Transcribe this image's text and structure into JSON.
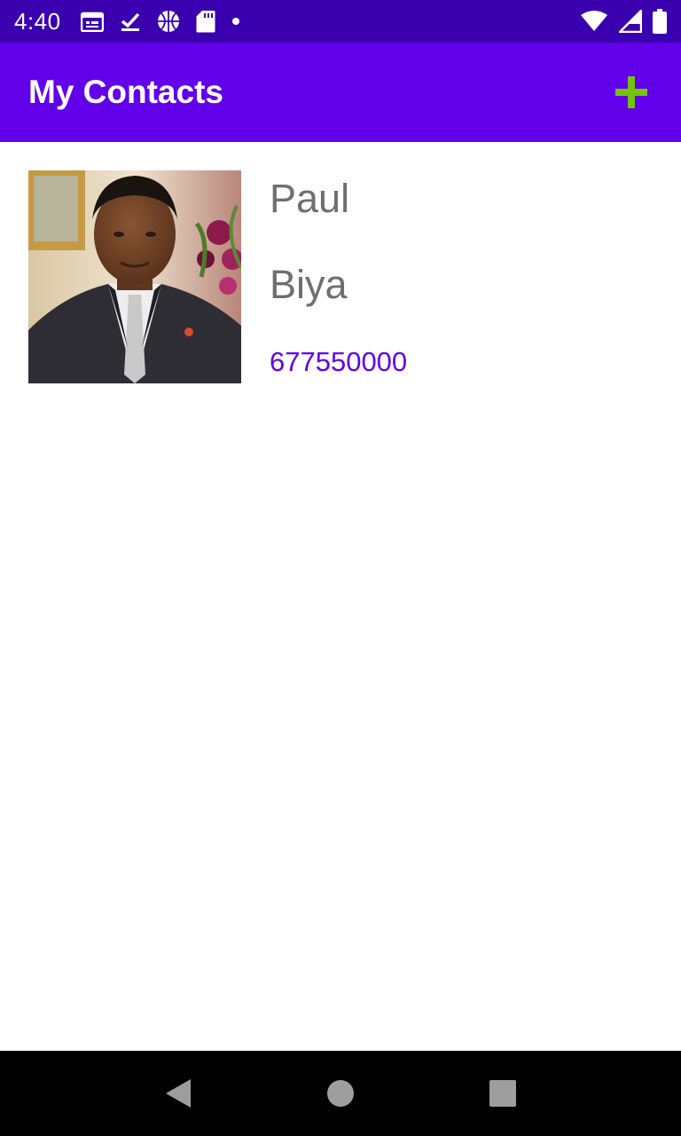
{
  "status_bar": {
    "time": "4:40",
    "left_icons": [
      "calendar-icon",
      "download-done-icon",
      "basketball-icon",
      "sd-card-icon",
      "dot-icon"
    ],
    "right_icons": [
      "wifi-icon",
      "signal-icon",
      "battery-icon"
    ]
  },
  "app_bar": {
    "title": "My Contacts",
    "add_icon": "plus-icon",
    "add_icon_color": "#76c30e",
    "background": "#6200ea"
  },
  "contacts": [
    {
      "first_name": "Paul",
      "last_name": "Biya",
      "phone": "677550000"
    }
  ],
  "nav_bar": {
    "buttons": [
      "back-icon",
      "home-icon",
      "recents-icon"
    ]
  }
}
